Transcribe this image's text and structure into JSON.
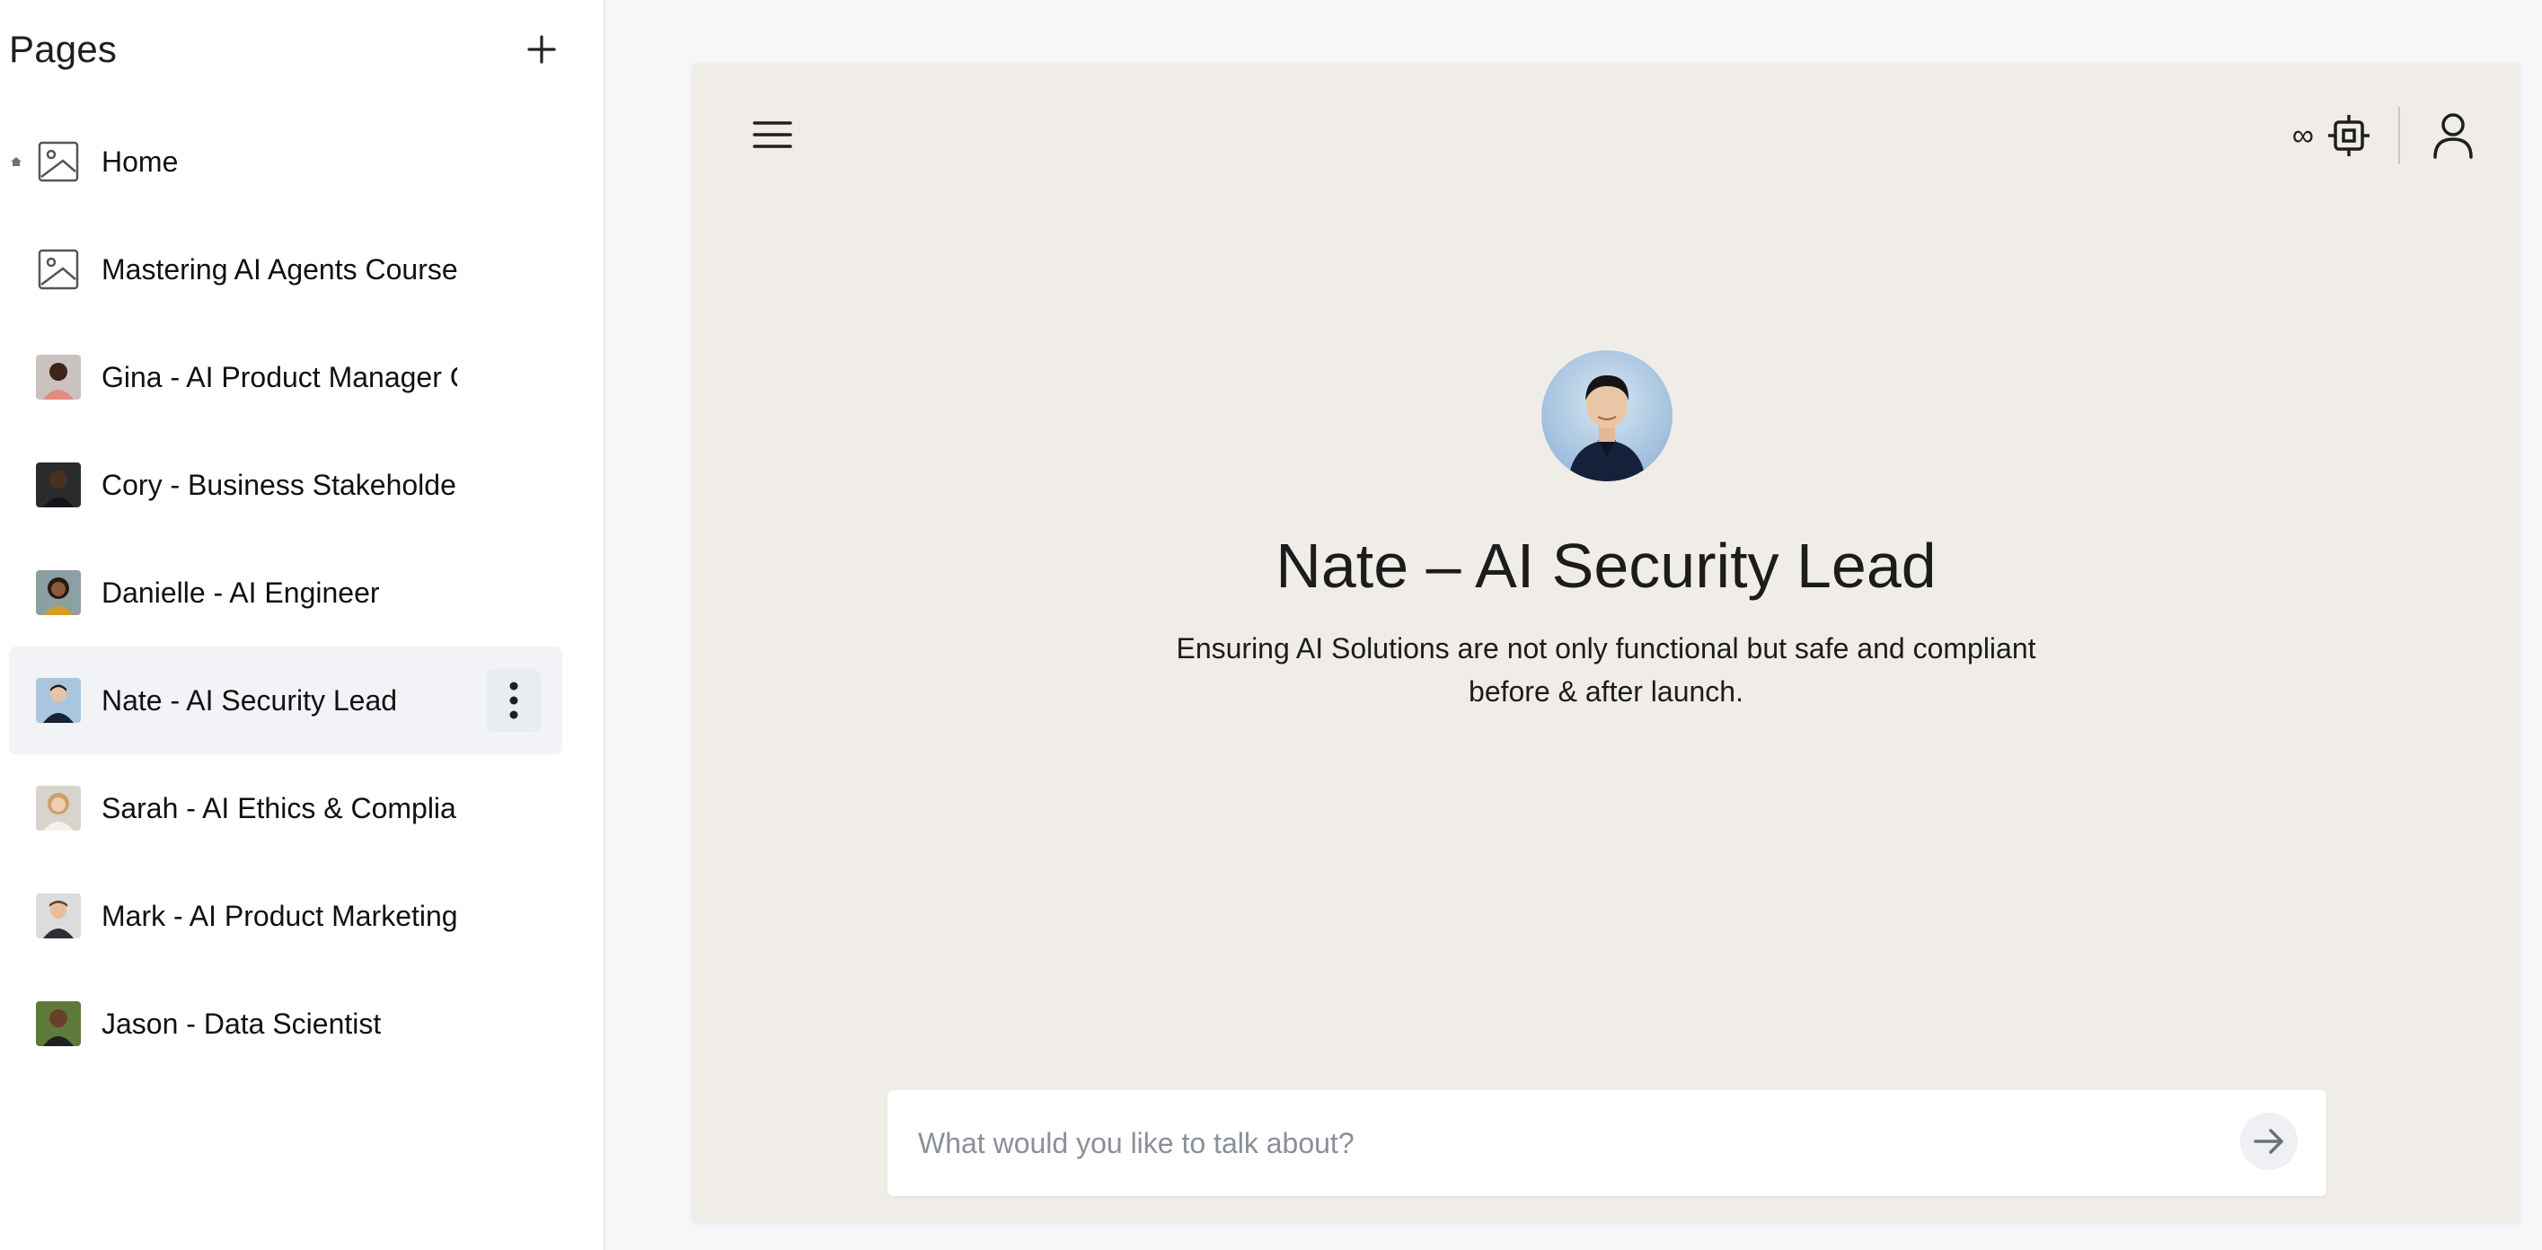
{
  "sidebar": {
    "title": "Pages",
    "add_icon": "plus-icon",
    "items": [
      {
        "label": "Home",
        "thumb": "image-placeholder-icon",
        "is_home": true
      },
      {
        "label": "Mastering AI Agents Course",
        "thumb": "image-placeholder-icon"
      },
      {
        "label": "Gina - AI Product Manager Coach",
        "thumb": "portrait-photo"
      },
      {
        "label": "Cory - Business Stakeholder",
        "thumb": "portrait-photo"
      },
      {
        "label": "Danielle - AI Engineer",
        "thumb": "portrait-photo"
      },
      {
        "label": "Nate - AI Security Lead",
        "thumb": "portrait-photo",
        "active": true
      },
      {
        "label": "Sarah - AI Ethics & Compliance",
        "thumb": "portrait-photo"
      },
      {
        "label": "Mark - AI Product Marketing",
        "thumb": "portrait-photo"
      },
      {
        "label": "Jason - Data Scientist",
        "thumb": "portrait-photo"
      }
    ]
  },
  "header": {
    "menu_icon": "hamburger-menu-icon",
    "infinity_symbol": "∞",
    "model_icon": "chip-icon",
    "user_icon": "user-icon"
  },
  "agent": {
    "name": "Nate – AI Security Lead",
    "description": "Ensuring AI Solutions are not only functional but safe and compliant before & after launch."
  },
  "chat": {
    "placeholder": "What would you like to talk about?",
    "send_icon": "arrow-right-icon"
  },
  "colors": {
    "card_bg": "#f0ede9",
    "page_bg": "#f6f7f9",
    "active_item_bg": "#f1f3f6"
  }
}
